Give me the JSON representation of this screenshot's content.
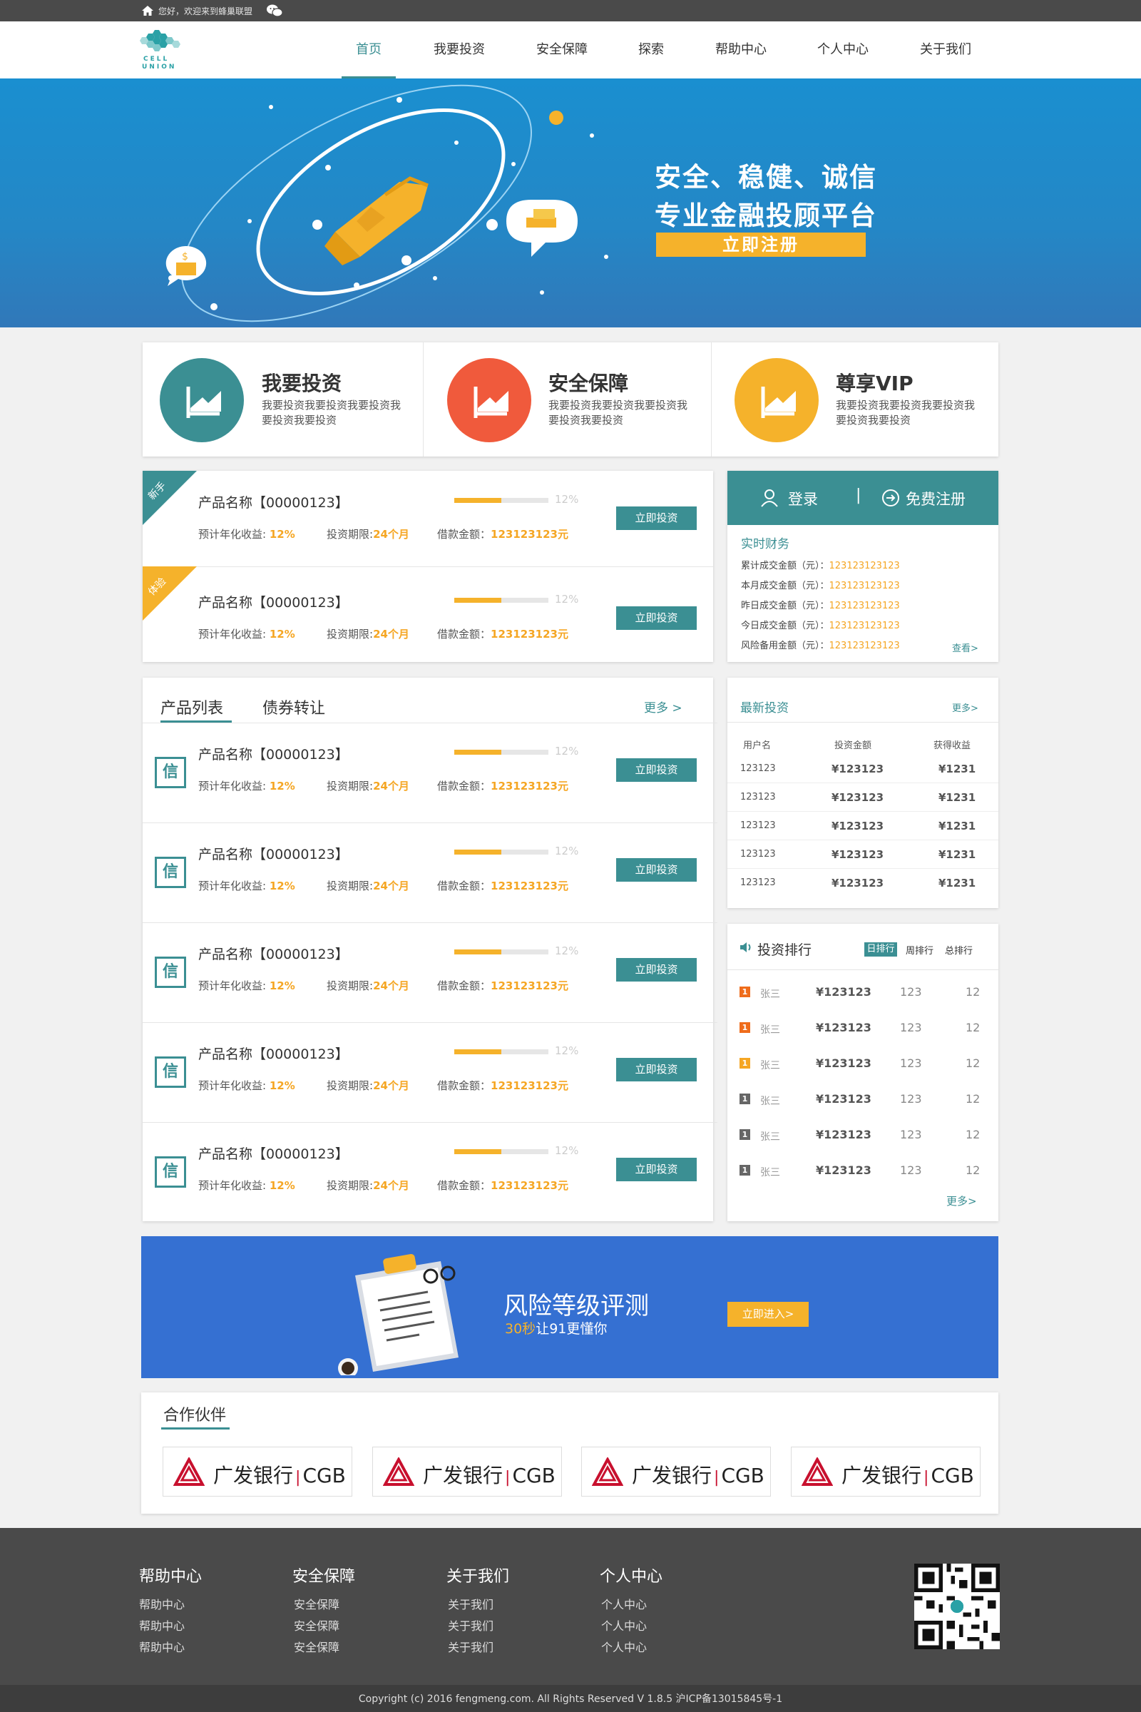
{
  "topbar": {
    "greeting": "您好，欢迎来到蜂巢联盟"
  },
  "logo": {
    "line1": "CELL",
    "line2": "UNION"
  },
  "nav": [
    "首页",
    "我要投资",
    "安全保障",
    "探索",
    "帮助中心",
    "个人中心",
    "关于我们"
  ],
  "banner": {
    "line1": "安全、稳健、诚信",
    "line2": "专业金融投顾平台",
    "button": "立即注册"
  },
  "features": [
    {
      "title": "我要投资",
      "desc": "我要投资我要投资我要投资我要投资我要投资",
      "color": "#3b8f93"
    },
    {
      "title": "安全保障",
      "desc": "我要投资我要投资我要投资我要投资我要投资",
      "color": "#f05a3c"
    },
    {
      "title": "尊享VIP",
      "desc": "我要投资我要投资我要投资我要投资我要投资",
      "color": "#f5b22b"
    }
  ],
  "featured": [
    {
      "tag": "新手",
      "tag_color": "#3b8f93",
      "name": "产品名称【00000123】",
      "progress": 0.5,
      "pct": "12%",
      "rate_label": "预计年化收益:",
      "rate": "12%",
      "term_label": "投资期限:",
      "term": "24个月",
      "amount_label": "借款金额：",
      "amount": "123123123元",
      "button": "立即投资"
    },
    {
      "tag": "体验",
      "tag_color": "#f5b22b",
      "name": "产品名称【00000123】",
      "progress": 0.5,
      "pct": "12%",
      "rate_label": "预计年化收益:",
      "rate": "12%",
      "term_label": "投资期限:",
      "term": "24个月",
      "amount_label": "借款金额：",
      "amount": "123123123元",
      "button": "立即投资"
    }
  ],
  "login": {
    "login": "登录",
    "sep": "|",
    "register": "免费注册"
  },
  "realtime": {
    "title": "实时财务",
    "rows": [
      {
        "label": "累计成交金额（元）：",
        "value": "123123123123"
      },
      {
        "label": "本月成交金额（元）：",
        "value": "123123123123"
      },
      {
        "label": "昨日成交金额（元）：",
        "value": "123123123123"
      },
      {
        "label": "今日成交金额（元）：",
        "value": "123123123123"
      },
      {
        "label": "风险备用金额（元）：",
        "value": "123123123123"
      }
    ],
    "more": "查看>"
  },
  "products": {
    "tabs": [
      "产品列表",
      "债券转让"
    ],
    "more": "更多 >",
    "badge": "信",
    "items": [
      {
        "name": "产品名称【00000123】",
        "progress": 0.5,
        "pct": "12%",
        "rate_label": "预计年化收益:",
        "rate": "12%",
        "term_label": "投资期限:",
        "term": "24个月",
        "amount_label": "借款金额：",
        "amount": "123123123元",
        "button": "立即投资"
      },
      {
        "name": "产品名称【00000123】",
        "progress": 0.5,
        "pct": "12%",
        "rate_label": "预计年化收益:",
        "rate": "12%",
        "term_label": "投资期限:",
        "term": "24个月",
        "amount_label": "借款金额：",
        "amount": "123123123元",
        "button": "立即投资"
      },
      {
        "name": "产品名称【00000123】",
        "progress": 0.5,
        "pct": "12%",
        "rate_label": "预计年化收益:",
        "rate": "12%",
        "term_label": "投资期限:",
        "term": "24个月",
        "amount_label": "借款金额：",
        "amount": "123123123元",
        "button": "立即投资"
      },
      {
        "name": "产品名称【00000123】",
        "progress": 0.5,
        "pct": "12%",
        "rate_label": "预计年化收益:",
        "rate": "12%",
        "term_label": "投资期限:",
        "term": "24个月",
        "amount_label": "借款金额：",
        "amount": "123123123元",
        "button": "立即投资"
      },
      {
        "name": "产品名称【00000123】",
        "progress": 0.5,
        "pct": "12%",
        "rate_label": "预计年化收益:",
        "rate": "12%",
        "term_label": "投资期限:",
        "term": "24个月",
        "amount_label": "借款金额：",
        "amount": "123123123元",
        "button": "立即投资"
      }
    ]
  },
  "latest": {
    "title": "最新投资",
    "more": "更多>",
    "headers": [
      "用户名",
      "投资金额",
      "获得收益"
    ],
    "rows": [
      [
        "123123",
        "¥123123",
        "¥1231"
      ],
      [
        "123123",
        "¥123123",
        "¥1231"
      ],
      [
        "123123",
        "¥123123",
        "¥1231"
      ],
      [
        "123123",
        "¥123123",
        "¥1231"
      ],
      [
        "123123",
        "¥123123",
        "¥1231"
      ]
    ]
  },
  "ranking": {
    "title": "投资排行",
    "tabs": [
      "日排行",
      "周排行",
      "总排行"
    ],
    "rows": [
      {
        "rank": "1",
        "name": "张三",
        "amount": "¥123123",
        "n1": "123",
        "n2": "12",
        "color": "#ef6c1b"
      },
      {
        "rank": "1",
        "name": "张三",
        "amount": "¥123123",
        "n1": "123",
        "n2": "12",
        "color": "#ef6c1b"
      },
      {
        "rank": "1",
        "name": "张三",
        "amount": "¥123123",
        "n1": "123",
        "n2": "12",
        "color": "#f5a623"
      },
      {
        "rank": "1",
        "name": "张三",
        "amount": "¥123123",
        "n1": "123",
        "n2": "12",
        "color": "#666666"
      },
      {
        "rank": "1",
        "name": "张三",
        "amount": "¥123123",
        "n1": "123",
        "n2": "12",
        "color": "#666666"
      },
      {
        "rank": "1",
        "name": "张三",
        "amount": "¥123123",
        "n1": "123",
        "n2": "12",
        "color": "#666666"
      }
    ],
    "more": "更多>"
  },
  "risk": {
    "title": "风险等级评测",
    "sub_gold": "30秒",
    "sub_rest": "让91更懂你",
    "button": "立即进入>"
  },
  "partners": {
    "title": "合作伙伴",
    "name": "广发银行",
    "sep": "|",
    "code": "CGB",
    "count": 4
  },
  "footer": {
    "cols": [
      {
        "title": "帮助中心",
        "links": [
          "帮助中心",
          "帮助中心",
          "帮助中心"
        ]
      },
      {
        "title": "安全保障",
        "links": [
          "安全保障",
          "安全保障",
          "安全保障"
        ]
      },
      {
        "title": "关于我们",
        "links": [
          "关于我们",
          "关于我们",
          "关于我们"
        ]
      },
      {
        "title": "个人中心",
        "links": [
          "个人中心",
          "个人中心",
          "个人中心"
        ]
      }
    ],
    "copyright": "Copyright (c) 2016 fengmeng.com. All Rights Reserved V 1.8.5 沪ICP备13015845号-1"
  },
  "icons": [
    "home-icon",
    "wechat-icon",
    "user-icon",
    "arrow-circle-icon",
    "speaker-icon",
    "chart-icon",
    "clipboard-icon",
    "bank-logo-icon",
    "qr-code-icon"
  ],
  "colors": {
    "accent": "#3b8f93",
    "gold": "#f5a623",
    "orange": "#f05a3c",
    "yellow": "#f5b22b",
    "banner": "#1a8fd0",
    "risk_banner": "#3570d2",
    "footer": "#4a4a4a"
  }
}
